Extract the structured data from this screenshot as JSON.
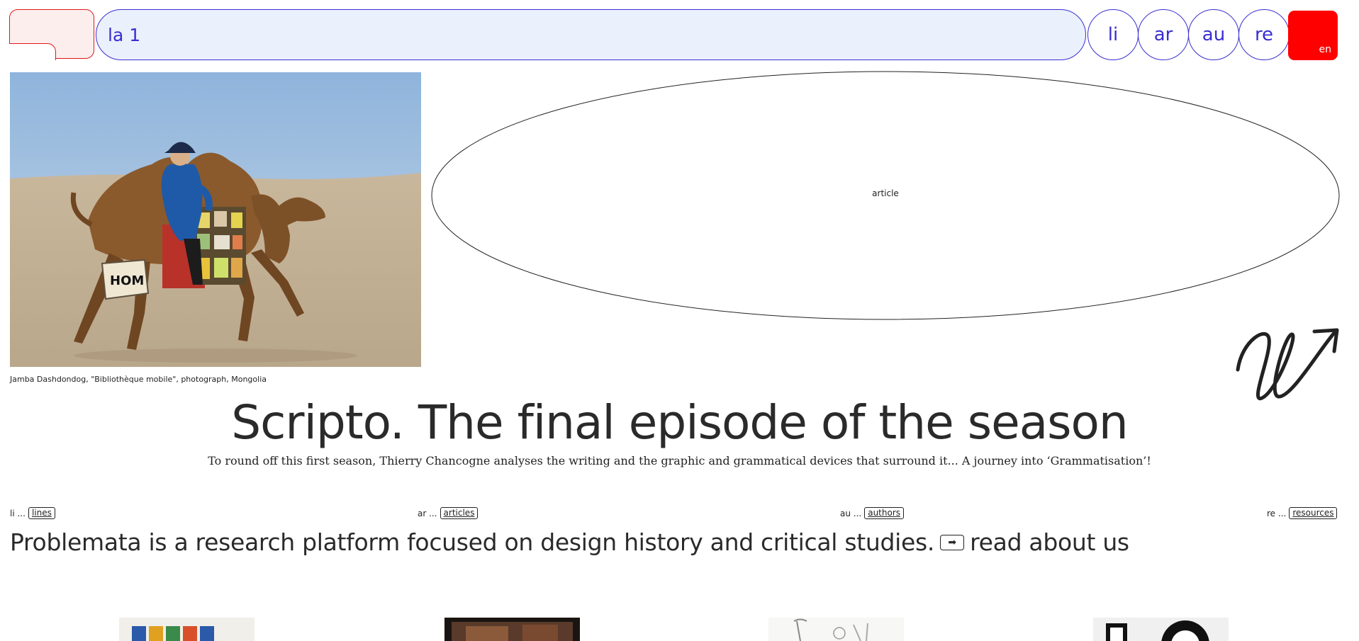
{
  "header": {
    "search_value": "la 1",
    "nav": [
      "li",
      "ar",
      "au",
      "re"
    ],
    "lang": "en"
  },
  "hero": {
    "caption": "Jamba Dashdondog, \"Bibliothèque mobile\", photograph, Mongolia",
    "box_text": "HOM",
    "ellipse_label": "article"
  },
  "article": {
    "title": "Scripto. The final episode of the season",
    "summary": "To round off this first season, Thierry Chancogne analyses the writing and the graphic and grammatical devices that surround it... A journey into ‘Grammatisation’!"
  },
  "sections": [
    {
      "prefix": "li ...",
      "label": "lines"
    },
    {
      "prefix": "ar ...",
      "label": "articles"
    },
    {
      "prefix": "au ...",
      "label": "authors"
    },
    {
      "prefix": "re ...",
      "label": "resources"
    }
  ],
  "tagline": {
    "text": "Problemata is a research platform focused on design history and critical studies.",
    "link": "read about us"
  },
  "colors": {
    "accent_blue": "#3a2fd1",
    "accent_red": "#ff0000",
    "search_bg": "#ebf0fd"
  },
  "icons": [
    "arrow-right-icon",
    "scribble-arrow-logo"
  ]
}
